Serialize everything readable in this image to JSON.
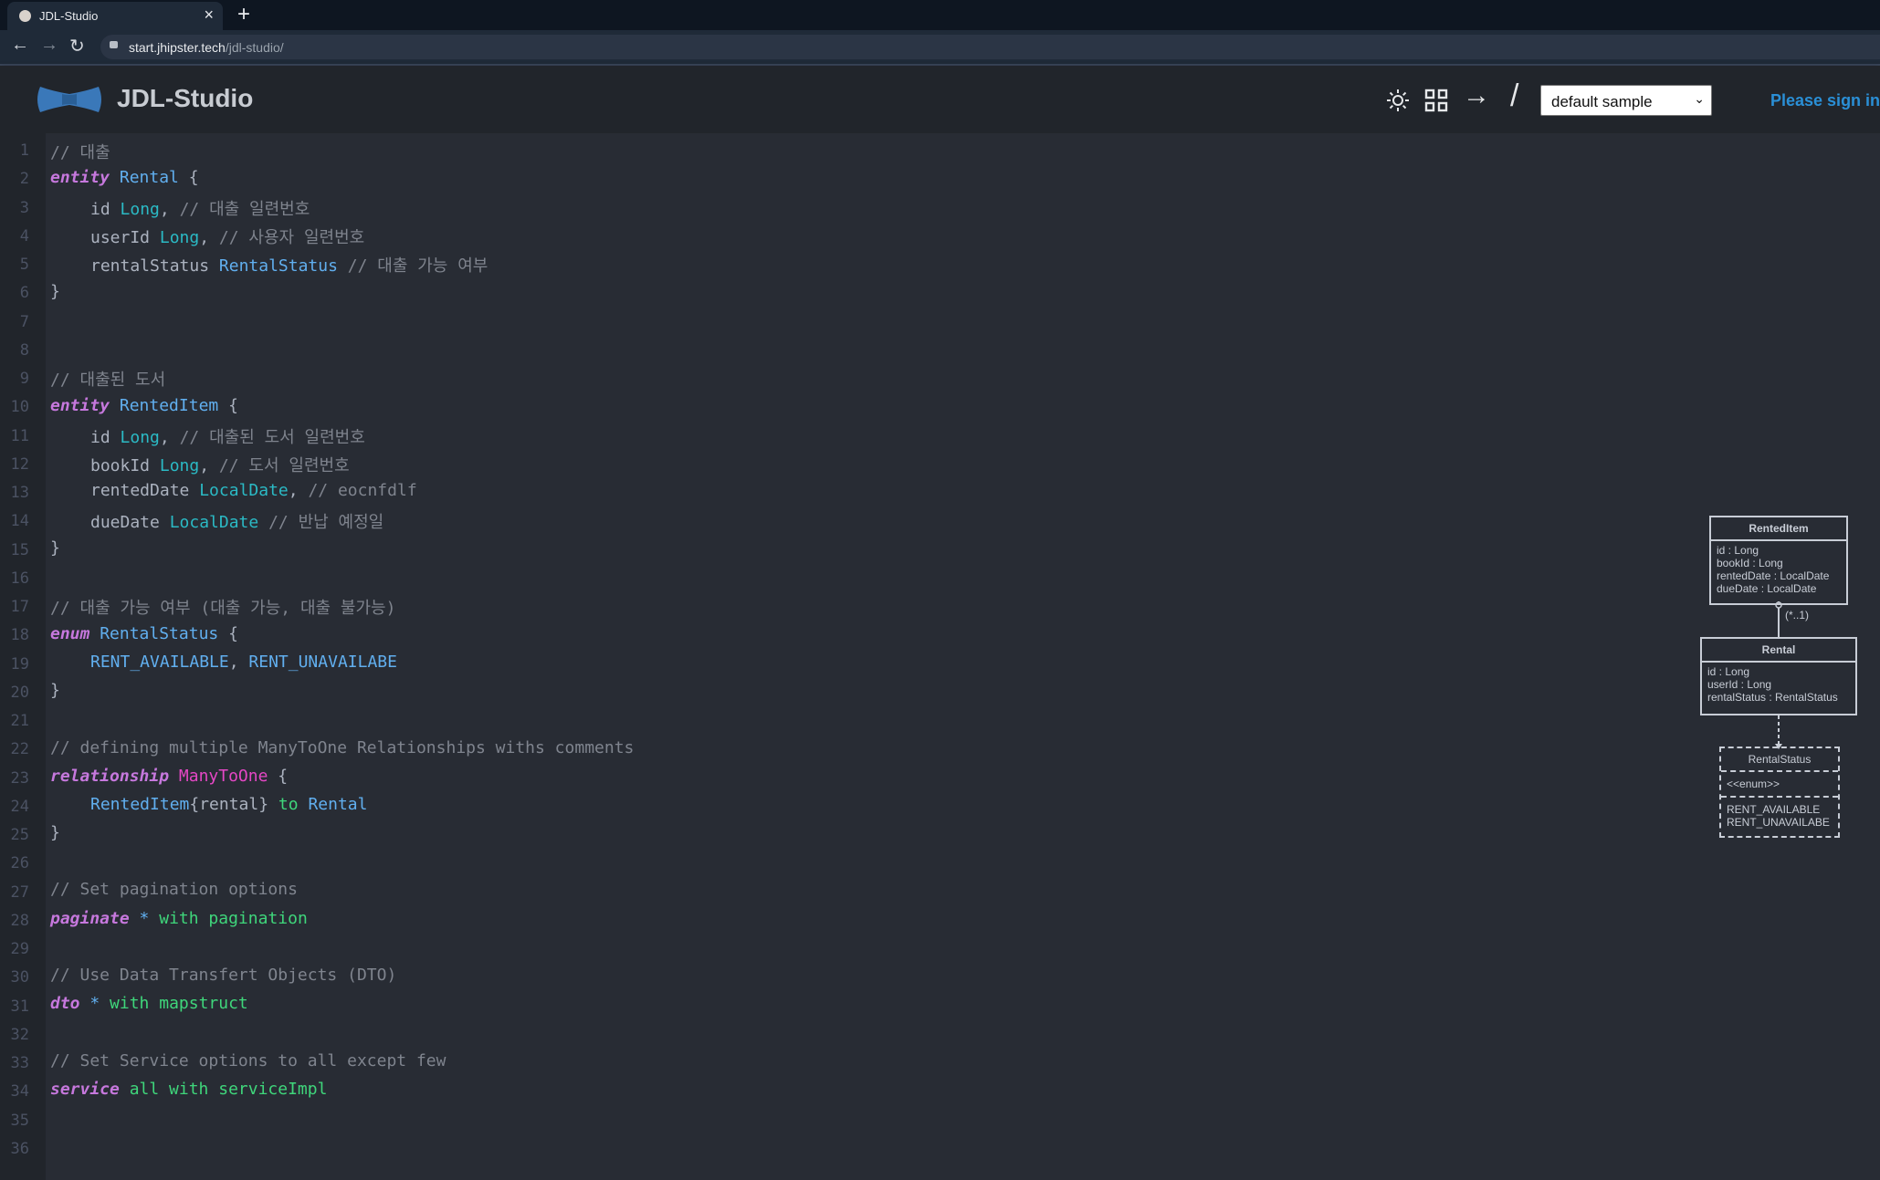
{
  "browser": {
    "tab_title": "JDL-Studio",
    "url_host": "start.jhipster.tech",
    "url_path": "/jdl-studio/"
  },
  "app": {
    "title": "JDL-Studio",
    "sample_select": "default sample",
    "signin": "Please sign in"
  },
  "editor": {
    "line_numbers": [
      "1",
      "2",
      "3",
      "4",
      "5",
      "6",
      "7",
      "8",
      "9",
      "10",
      "11",
      "12",
      "13",
      "14",
      "15",
      "16",
      "17",
      "18",
      "19",
      "20",
      "21",
      "22",
      "23",
      "24",
      "25",
      "26",
      "27",
      "28",
      "29",
      "30",
      "31",
      "32",
      "33",
      "34",
      "35",
      "36"
    ],
    "l1": "// 대출",
    "l2": [
      "entity",
      "Rental",
      "{"
    ],
    "l3": [
      "id",
      "Long",
      ",",
      "// 대출 일련번호"
    ],
    "l4": [
      "userId",
      "Long",
      ",",
      "// 사용자 일련번호"
    ],
    "l5": [
      "rentalStatus",
      "RentalStatus",
      "// 대출 가능 여부"
    ],
    "l6": "}",
    "l9": "// 대출된 도서",
    "l10": [
      "entity",
      "RentedItem",
      "{"
    ],
    "l11": [
      "id",
      "Long",
      ",",
      "// 대출된 도서 일련번호"
    ],
    "l12": [
      "bookId",
      "Long",
      ",",
      "// 도서 일련번호"
    ],
    "l13": [
      "rentedDate",
      "LocalDate",
      ",",
      "// eocnfdlf"
    ],
    "l14": [
      "dueDate",
      "LocalDate",
      "// 반납 예정일"
    ],
    "l15": "}",
    "l17": "// 대출 가능 여부 (대출 가능, 대출 불가능)",
    "l18": [
      "enum",
      "RentalStatus",
      "{"
    ],
    "l19": [
      "RENT_AVAILABLE",
      ",",
      "RENT_UNAVAILABE"
    ],
    "l20": "}",
    "l22": "// defining multiple ManyToOne Relationships withs comments",
    "l23": [
      "relationship",
      "ManyToOne",
      "{"
    ],
    "l24": [
      "RentedItem",
      "{rental}",
      "to",
      "Rental"
    ],
    "l25": "}",
    "l27": "// Set pagination options",
    "l28": [
      "paginate",
      "*",
      "with pagination"
    ],
    "l30": "// Use Data Transfert Objects (DTO)",
    "l31": [
      "dto",
      "*",
      "with mapstruct"
    ],
    "l33": "// Set Service options to all except few",
    "l34": [
      "service",
      "all with serviceImpl"
    ]
  },
  "diagram": {
    "rented_item": {
      "name": "RentedItem",
      "fields": [
        "id : Long",
        "bookId : Long",
        "rentedDate : LocalDate",
        "dueDate : LocalDate"
      ]
    },
    "multiplicity": "(*..1)",
    "rental": {
      "name": "Rental",
      "fields": [
        "id : Long",
        "userId : Long",
        "rentalStatus : RentalStatus"
      ]
    },
    "rental_status": {
      "name": "RentalStatus",
      "stereotype": "<<enum>>",
      "values": [
        "RENT_AVAILABLE",
        "RENT_UNAVAILABE"
      ]
    }
  },
  "icons": [
    "sun-icon",
    "grid-icon",
    "arrow-right-icon",
    "slash-icon",
    "logo-icon"
  ]
}
